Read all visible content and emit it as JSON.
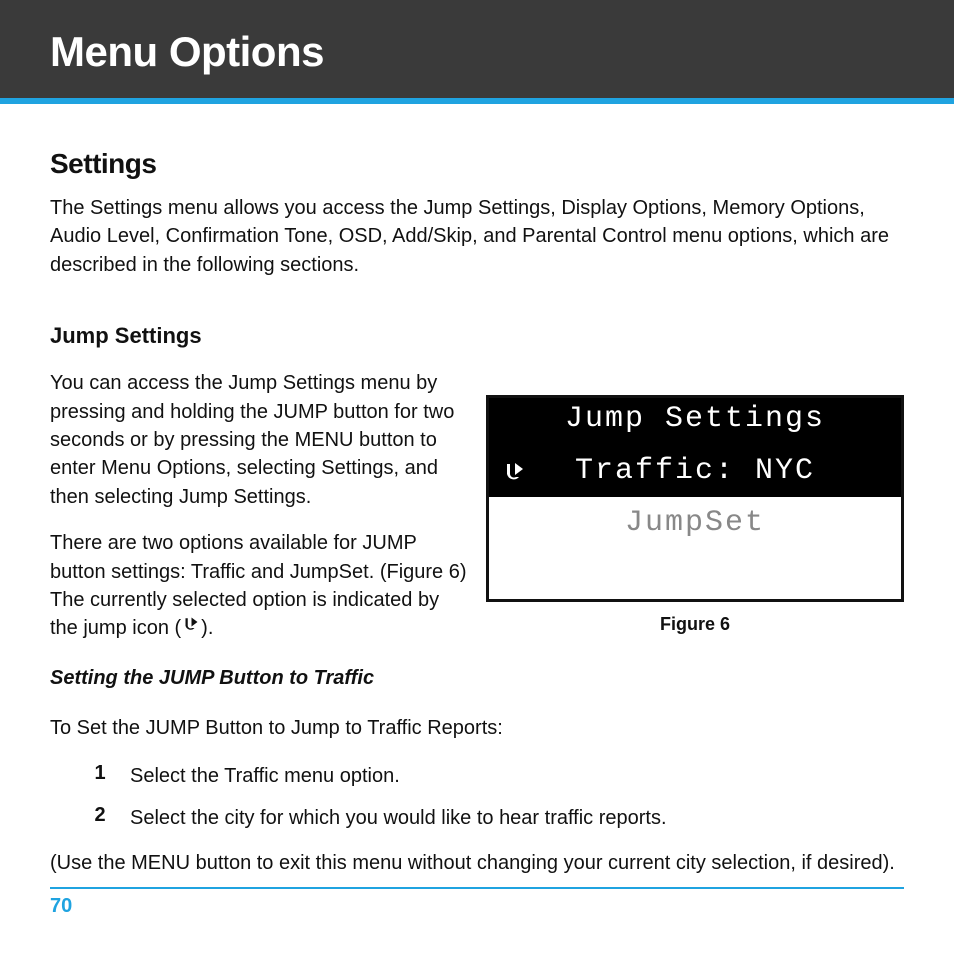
{
  "header": {
    "title": "Menu Options"
  },
  "section": {
    "heading": "Settings",
    "intro": "The Settings menu allows you access the Jump Settings, Display Options, Memory Options, Audio Level, Confirmation Tone, OSD, Add/Skip, and Parental Control menu options, which are described in the following sections."
  },
  "jump": {
    "heading": "Jump Settings",
    "para1": "You can access the Jump Settings menu by pressing and holding the JUMP button for two seconds or by pressing the MENU button to enter Menu Options, selecting Settings, and then selecting Jump Settings.",
    "para2_pre": "There are two options available for JUMP button settings: Traffic and JumpSet. (Figure 6) The currently selected option is indicated by the jump icon (",
    "para2_post": ").",
    "subheading": "Setting the JUMP Button to Traffic",
    "instruction": "To Set the JUMP Button to Jump to Traffic Reports:",
    "steps": [
      {
        "num": "1",
        "text": "Select the Traffic menu option."
      },
      {
        "num": "2",
        "text": "Select the city for which you would like to hear traffic reports."
      }
    ],
    "note": "(Use the MENU button to exit this menu without changing your current city selection, if desired)."
  },
  "figure": {
    "title": "Jump Settings",
    "row_selected": "Traffic: NYC",
    "row_unselected": "JumpSet",
    "caption": "Figure 6"
  },
  "page_number": "70"
}
